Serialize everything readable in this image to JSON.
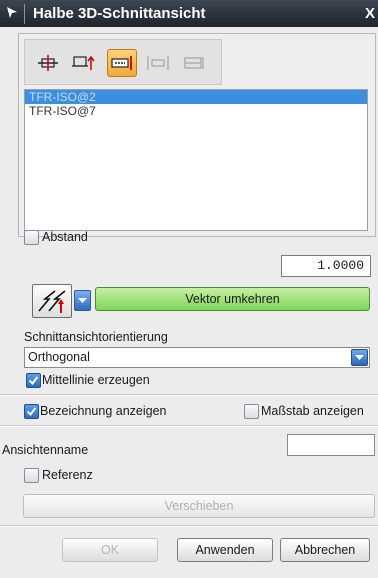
{
  "window": {
    "title": "Halbe 3D-Schnittansicht",
    "app_icon": "arrow-cursor-icon",
    "close_glyph": "X"
  },
  "toolbar": {
    "icons": [
      {
        "name": "section-plane-icon",
        "active": false,
        "disabled": false
      },
      {
        "name": "section-direction-icon",
        "active": false,
        "disabled": false
      },
      {
        "name": "section-offset-icon",
        "active": true,
        "disabled": false
      },
      {
        "name": "section-step-icon",
        "active": false,
        "disabled": true
      },
      {
        "name": "section-bend-icon",
        "active": false,
        "disabled": true
      }
    ]
  },
  "views_list": {
    "items": [
      {
        "label": "TFR-ISO@2",
        "selected": true
      },
      {
        "label": "TFR-ISO@7",
        "selected": false
      }
    ]
  },
  "abstand": {
    "label": "Abstand",
    "checked": false,
    "value": "1.0000"
  },
  "vector": {
    "icon": "vector-direction-icon",
    "dropdown_icon": "chevron-down-icon",
    "reverse_label": "Vektor umkehren"
  },
  "orientation": {
    "heading": "Schnittansichtorientierung",
    "selected": "Orthogonal",
    "mittellinie": {
      "label": "Mittellinie erzeugen",
      "checked": true
    }
  },
  "options": {
    "bezeichnung": {
      "label": "Bezeichnung anzeigen",
      "checked": true
    },
    "massstab": {
      "label": "Maßstab anzeigen",
      "checked": false
    },
    "ansichtenname": {
      "label": "Ansichtenname",
      "value": ""
    },
    "referenz": {
      "label": "Referenz",
      "checked": false
    }
  },
  "buttons": {
    "move": "Verschieben",
    "ok": "OK",
    "apply": "Anwenden",
    "cancel": "Abbrechen"
  },
  "colors": {
    "titlebar": "#2a323c",
    "selection": "#3c8ee0",
    "green_button": "#9fe27a",
    "active_tool": "#f5b445"
  }
}
